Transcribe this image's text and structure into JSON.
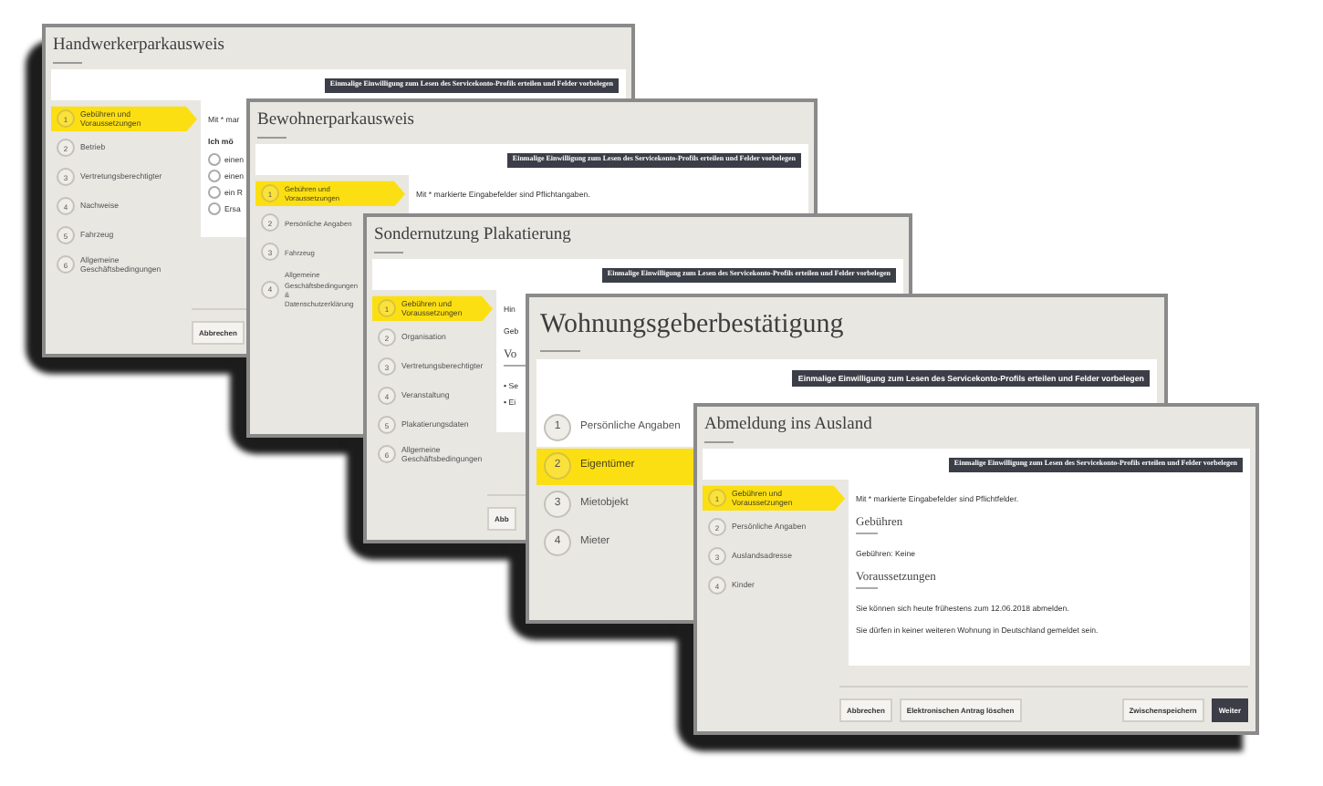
{
  "windows": [
    {
      "title": "Handwerkerparkausweis",
      "consent_button": "Einmalige Einwilligung zum Lesen des Servicekonto-Profils erteilen und Felder vorbelegen",
      "steps": [
        {
          "number": "1",
          "label": "Gebühren und Voraussetzungen",
          "selected": true,
          "done": false
        },
        {
          "number": "2",
          "label": "Betrieb",
          "selected": false,
          "done": false
        },
        {
          "number": "3",
          "label": "Vertretungsberechtigter",
          "selected": false,
          "done": false
        },
        {
          "number": "4",
          "label": "Nachweise",
          "selected": false,
          "done": false
        },
        {
          "number": "5",
          "label": "Fahrzeug",
          "selected": false,
          "done": false
        },
        {
          "number": "6",
          "label": "Allgemeine Geschäftsbedingungen",
          "selected": false,
          "done": false
        }
      ],
      "blocks": [
        {
          "kind": "note",
          "text": "Mit * mar"
        },
        {
          "kind": "label",
          "text": "Ich mö"
        },
        {
          "kind": "radio",
          "text": "einen",
          "checked": false
        },
        {
          "kind": "radio",
          "text": "einen",
          "checked": false
        },
        {
          "kind": "radio",
          "text": "ein R",
          "checked": false
        },
        {
          "kind": "radio",
          "text": "Ersa",
          "checked": false
        }
      ],
      "footer_left": [
        {
          "label": "Abbrechen",
          "kind": "plain"
        }
      ]
    },
    {
      "title": "Bewohnerparkausweis",
      "consent_button": "Einmalige Einwilligung zum Lesen des Servicekonto-Profils erteilen und Felder vorbelegen",
      "steps": [
        {
          "number": "1",
          "label": "Gebühren und Voraussetzungen",
          "selected": true,
          "done": false
        },
        {
          "number": "2",
          "label": "Persönliche Angaben",
          "selected": false,
          "done": false
        },
        {
          "number": "3",
          "label": "Fahrzeug",
          "selected": false,
          "done": false
        },
        {
          "number": "4",
          "label": "Allgemeine Geschäftsbedingungen & Datenschutzerklärung",
          "selected": false,
          "done": false
        }
      ],
      "blocks": [
        {
          "kind": "note",
          "text": "Mit * markierte Eingabefelder sind Pflichtangaben."
        }
      ]
    },
    {
      "title": "Sondernutzung Plakatierung",
      "consent_button": "Einmalige Einwilligung zum Lesen des Servicekonto-Profils erteilen und Felder vorbelegen",
      "steps": [
        {
          "number": "1",
          "label": "Gebühren und Voraussetzungen",
          "selected": true,
          "done": false
        },
        {
          "number": "2",
          "label": "Organisation",
          "selected": false,
          "done": false
        },
        {
          "number": "3",
          "label": "Vertretungsberechtigter",
          "selected": false,
          "done": false
        },
        {
          "number": "4",
          "label": "Veranstaltung",
          "selected": false,
          "done": false
        },
        {
          "number": "5",
          "label": "Plakatierungsdaten",
          "selected": false,
          "done": false
        },
        {
          "number": "6",
          "label": "Allgemeine Geschäftsbedingungen",
          "selected": false,
          "done": false
        }
      ],
      "blocks": [
        {
          "kind": "note",
          "text": "Hin"
        },
        {
          "kind": "note",
          "text": "Geb"
        },
        {
          "kind": "heading",
          "text": "Vo"
        },
        {
          "kind": "bullet",
          "text": "• Se"
        },
        {
          "kind": "bullet",
          "text": "• Ei"
        }
      ],
      "footer_left": [
        {
          "label": "Abb",
          "kind": "plain"
        }
      ]
    },
    {
      "title": "Wohnungsgeberbestätigung",
      "consent_button": "Einmalige Einwilligung zum Lesen des Servicekonto-Profils erteilen und Felder vorbelegen",
      "steps": [
        {
          "number": "1",
          "label": "Persönliche Angaben",
          "selected": false,
          "done": true
        },
        {
          "number": "2",
          "label": "Eigentümer",
          "selected": true,
          "done": false
        },
        {
          "number": "3",
          "label": "Mietobjekt",
          "selected": false,
          "done": false
        },
        {
          "number": "4",
          "label": "Mieter",
          "selected": false,
          "done": false
        }
      ]
    },
    {
      "title": "Abmeldung ins Ausland",
      "consent_button": "Einmalige Einwilligung zum Lesen des Servicekonto-Profils erteilen und Felder vorbelegen",
      "steps": [
        {
          "number": "1",
          "label": "Gebühren und Voraussetzungen",
          "selected": true,
          "done": false
        },
        {
          "number": "2",
          "label": "Persönliche Angaben",
          "selected": false,
          "done": false
        },
        {
          "number": "3",
          "label": "Auslandsadresse",
          "selected": false,
          "done": false
        },
        {
          "number": "4",
          "label": "Kinder",
          "selected": false,
          "done": false
        }
      ],
      "blocks": [
        {
          "kind": "note",
          "text": "Mit * markierte Eingabefelder sind Pflichtfelder."
        },
        {
          "kind": "heading",
          "text": "Gebühren"
        },
        {
          "kind": "note",
          "text": "Gebühren: Keine"
        },
        {
          "kind": "heading",
          "text": "Voraussetzungen"
        },
        {
          "kind": "note",
          "text": "Sie können sich heute frühestens zum 12.06.2018 abmelden."
        },
        {
          "kind": "note",
          "text": "Sie dürfen in keiner weiteren Wohnung in Deutschland gemeldet sein."
        }
      ],
      "footer_left": [
        {
          "label": "Abbrechen",
          "kind": "plain"
        },
        {
          "label": "Elektronischen Antrag löschen",
          "kind": "plain"
        }
      ],
      "footer_right": [
        {
          "label": "Zwischenspeichern",
          "kind": "plain"
        },
        {
          "label": "Weiter",
          "kind": "primary"
        }
      ]
    }
  ]
}
